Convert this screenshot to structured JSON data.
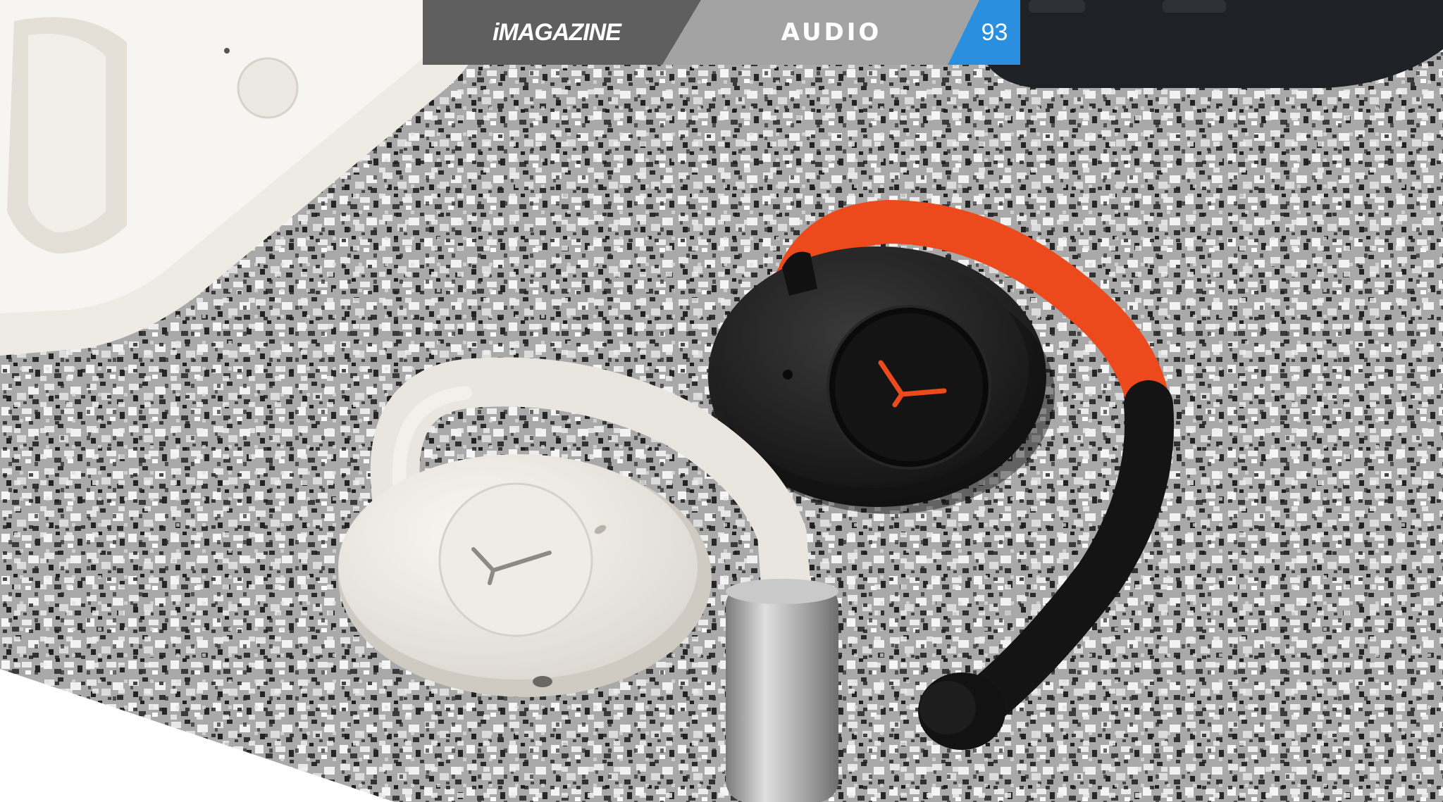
{
  "header": {
    "brand": "iMAGAZINE",
    "section": "AUDIO",
    "page_number": "93"
  },
  "colors": {
    "brand_bar": "#5f5f5f",
    "section_bar": "#a3a3a3",
    "page_bar": "#2a8fde",
    "accent_orange": "#ec4a1c"
  }
}
